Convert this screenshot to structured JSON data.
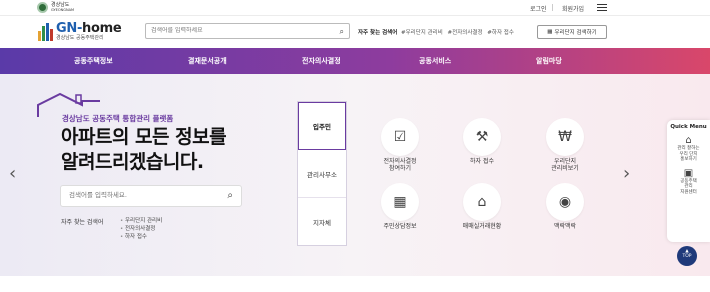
{
  "topbar": {
    "gov_logo": "경상남도",
    "gov_logo_sub": "GYEONGNAM",
    "login": "로그인",
    "signup": "회원가입"
  },
  "header": {
    "logo_title_prefix": "GN-",
    "logo_title_suffix": "home",
    "logo_sub": "경상남도 공동주택관리",
    "search_placeholder": "검색어를 입력하세요",
    "hot_keywords_label": "자주 찾는 검색어",
    "hot_keywords": [
      "#우리단지 관리비",
      "#전자의사결정",
      "#하자 접수"
    ],
    "apt_button": "우리단지 검색하기"
  },
  "nav": {
    "items": [
      "공동주택정보",
      "결재문서공개",
      "전자의사결정",
      "공동서비스",
      "알림마당"
    ]
  },
  "hero": {
    "subtitle": "경상남도 공동주택 통합관리 플랫폼",
    "title_line1": "아파트의 모든 정보를",
    "title_line2": "알려드리겠습니다.",
    "search_placeholder": "검색어를 입력하세요.",
    "fav_label": "자주 찾는 검색어",
    "fav_items": [
      "우리단지 관리비",
      "전자의사결정",
      "하자 접수"
    ]
  },
  "tabs": [
    "입주민",
    "관리사무소",
    "지자체"
  ],
  "active_tab": 0,
  "services": [
    {
      "label": "전자의사결정\n참여하기",
      "icon": "vote-icon"
    },
    {
      "label": "하자 접수",
      "icon": "repair-icon"
    },
    {
      "label": "우리단지\n관리비보기",
      "icon": "bill-icon"
    },
    {
      "label": "주민상담정보",
      "icon": "building-icon"
    },
    {
      "label": "매매실거래현황",
      "icon": "house-price-icon"
    },
    {
      "label": "맥락맥락",
      "icon": "location-icon"
    }
  ],
  "quick_menu": {
    "title": "Quick Menu",
    "items": [
      {
        "label": "관리 잘하는\n우리 단지\n홍보하기",
        "icon": "house-icon"
      },
      {
        "label": "공동주택\n관리\n지원센터",
        "icon": "support-icon"
      }
    ]
  },
  "top_button": "TOP",
  "colors": {
    "nav_start": "#5a3aa8",
    "nav_end": "#d9476a",
    "accent": "#6a3ba0",
    "top_button": "#1f3a7a"
  }
}
